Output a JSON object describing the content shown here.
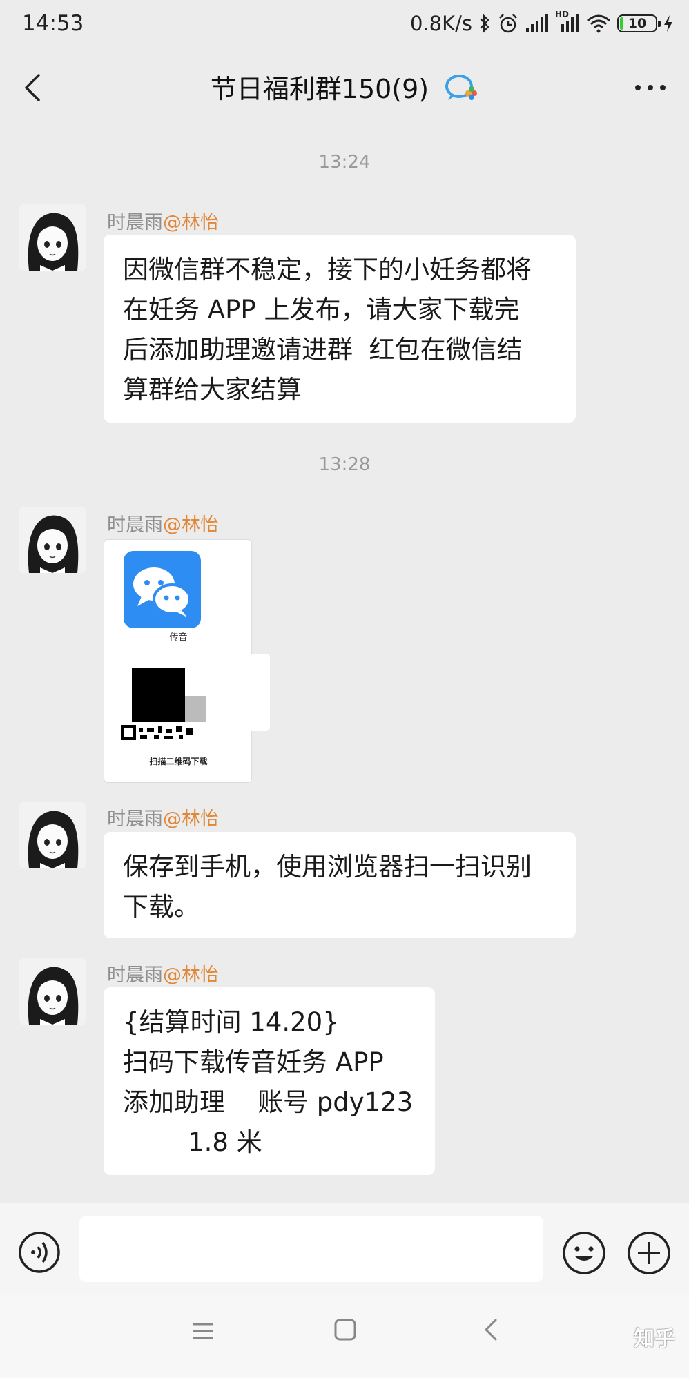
{
  "status_bar": {
    "time": "14:53",
    "network_speed": "0.8K/s",
    "signal_hd_label": "HD",
    "battery_level": "10"
  },
  "header": {
    "title": "节日福利群150(9)"
  },
  "messages": [
    {
      "time": "13:24",
      "sender": "时晨雨",
      "mention": "@林怡",
      "text_lines": [
        "因微信群不稳定，接下的小妊务都将",
        "在妊务 APP 上发布，请大家下载完",
        "后添加助理邀请进群  红包在微信结",
        "算群给大家结算"
      ]
    },
    {
      "time": "13:28",
      "sender": "时晨雨",
      "mention": "@林怡",
      "image": {
        "app_name": "传音",
        "caption": "扫描二维码下载"
      }
    },
    {
      "sender": "时晨雨",
      "mention": "@林怡",
      "text_lines": [
        "保存到手机，使用浏览器扫一扫识别",
        "下载。"
      ]
    },
    {
      "sender": "时晨雨",
      "mention": "@林怡",
      "text_lines": [
        "{结算时间 14.20}",
        "扫码下载传音妊务 APP",
        "添加助理    账号 pdy123",
        "        1.8 米"
      ]
    }
  ],
  "input": {
    "placeholder": ""
  },
  "watermark": "知乎"
}
